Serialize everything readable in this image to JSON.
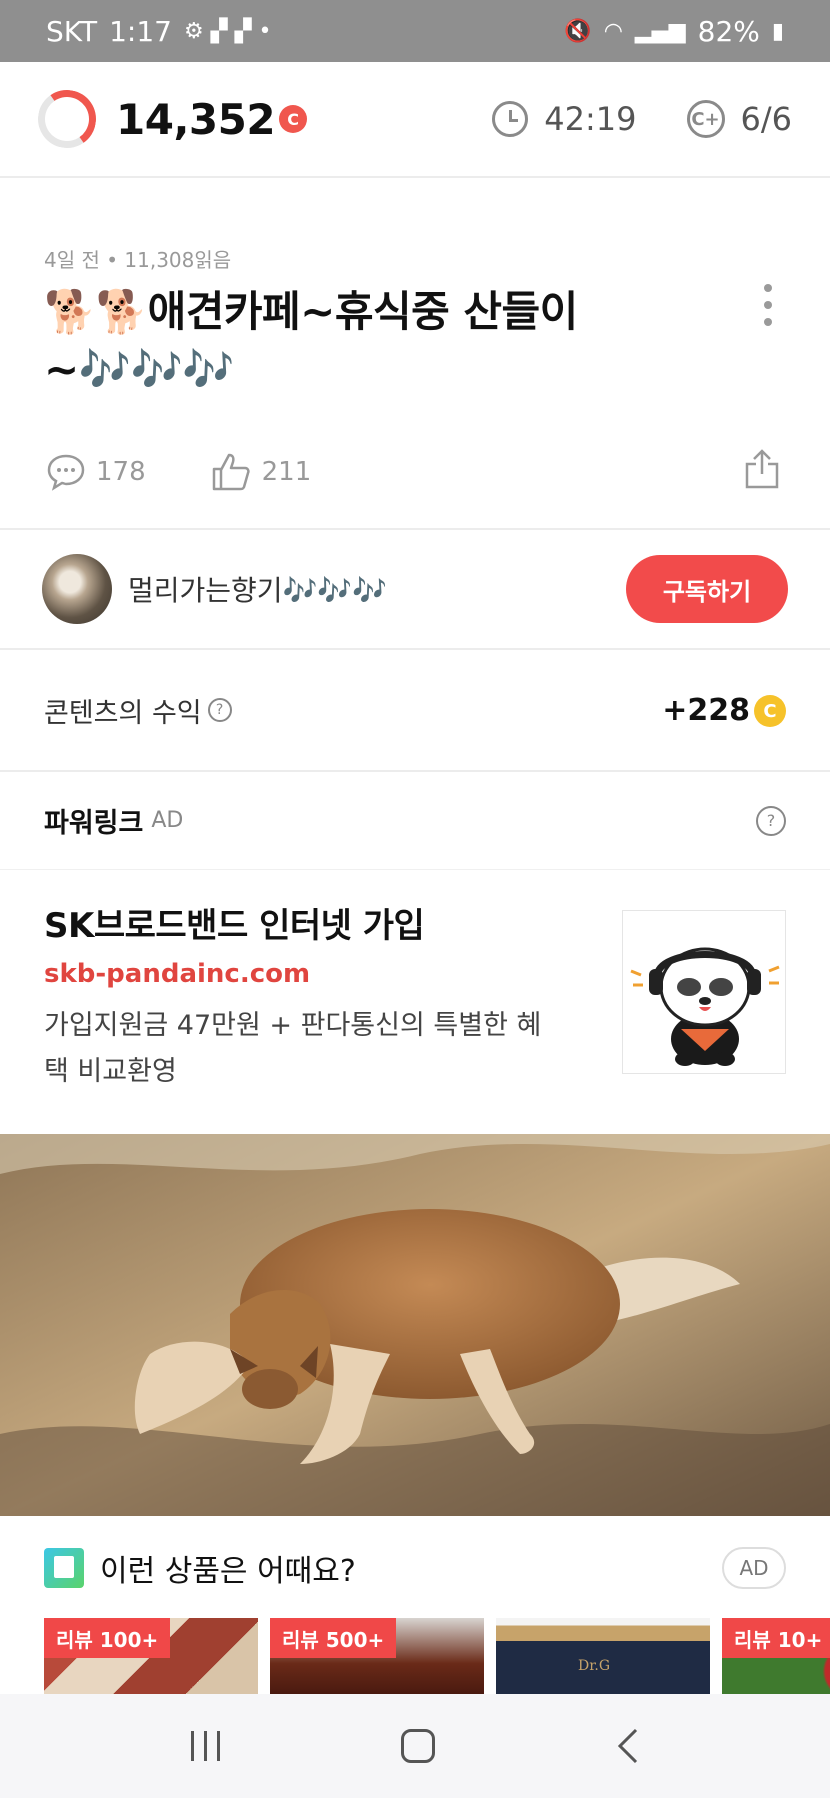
{
  "status_bar": {
    "carrier": "SKT",
    "time": "1:17",
    "battery": "82%"
  },
  "header": {
    "points": "14,352",
    "coin_symbol": "C",
    "timer": "42:19",
    "progress": "6/6"
  },
  "article": {
    "meta": "4일 전 • 11,308읽음",
    "title": "🐕🐕애견카페~휴식중 산들이 ~🎶🎶🎶",
    "comments": "178",
    "likes": "211"
  },
  "author": {
    "name": "멀리가는향기🎶🎶🎶",
    "subscribe_label": "구독하기"
  },
  "revenue": {
    "label": "콘텐츠의 수익",
    "value": "+228",
    "coin_symbol": "C"
  },
  "powerlink": {
    "title": "파워링크",
    "ad_tag": "AD"
  },
  "ad": {
    "title": "SK브로드밴드 인터넷 가입",
    "url": "skb-pandainc.com",
    "description": "가입지원금 47만원 + 판다통신의 특별한 혜택 비교환영"
  },
  "recommend": {
    "title": "이런 상품은 어때요?",
    "ad_tag": "AD",
    "products": [
      {
        "badge": "리뷰 100+"
      },
      {
        "badge": "리뷰 500+"
      },
      {
        "badge": ""
      },
      {
        "badge": "리뷰 10+"
      }
    ]
  },
  "colors": {
    "accent": "#f24b4b",
    "coin_yellow": "#f6c22a"
  }
}
